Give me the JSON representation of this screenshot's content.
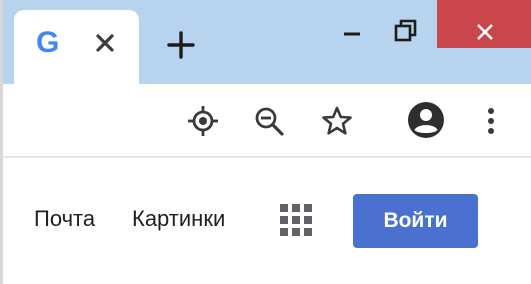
{
  "tab": {
    "favicon": "G",
    "favicon_icon": "google-g-icon",
    "close_icon": "close-icon"
  },
  "new_tab_icon": "plus-icon",
  "window_controls": {
    "minimize_icon": "minimize-icon",
    "restore_icon": "restore-icon",
    "close_icon": "close-icon",
    "close_color": "#c9464d"
  },
  "toolbar": {
    "icons": [
      "location-icon",
      "zoom-out-icon",
      "star-icon",
      "profile-icon",
      "more-vert-icon"
    ]
  },
  "page": {
    "links": {
      "mail": "Почта",
      "images": "Картинки"
    },
    "apps_icon": "apps-grid-icon",
    "signin_label": "Войти",
    "signin_color": "#4a71cf"
  },
  "colors": {
    "tabstrip": "#b7d3ee",
    "accent": "#4a71cf"
  }
}
